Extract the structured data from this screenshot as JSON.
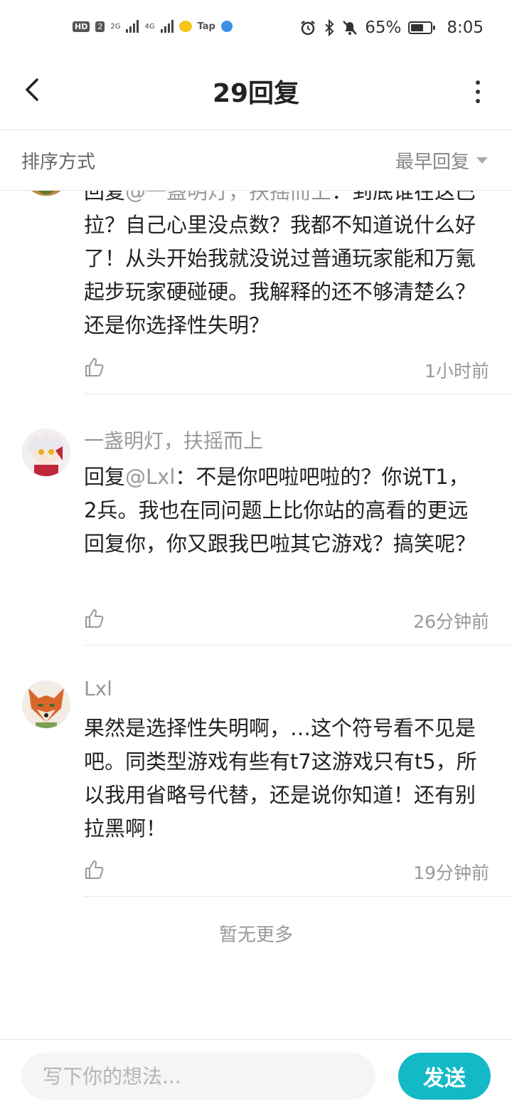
{
  "status_bar": {
    "left_labels": [
      "HD",
      "2",
      "2G",
      "4G",
      "Tap"
    ],
    "battery_text": "65%",
    "battery_level": 0.65,
    "time": "8:05",
    "icons": [
      "alarm-icon",
      "bluetooth-icon",
      "mute-icon",
      "battery-icon"
    ]
  },
  "header": {
    "title": "29回复",
    "back_icon": "chevron-left-icon",
    "more_icon": "more-vertical-icon"
  },
  "sort": {
    "label": "排序方式",
    "selected": "最早回复"
  },
  "comments": [
    {
      "author": "",
      "reply_prefix": "回复",
      "mention": "@一盏明灯，扶摇而上",
      "text": "：到底谁在这巴拉？自己心里没点数？我都不知道说什么好了！从头开始我就没说过普通玩家能和万氪起步玩家硬碰硬。我解释的还不够清楚么？还是你选择性失明？",
      "time": "1小时前"
    },
    {
      "author": "一盏明灯，扶摇而上",
      "reply_prefix": "回复",
      "mention": "@Lxl",
      "text": "：不是你吧啦吧啦的？你说T1，2兵。我也在同问题上比你站的高看的更远回复你，你又跟我巴啦其它游戏？搞笑呢？",
      "time": "26分钟前"
    },
    {
      "author": "Lxl",
      "reply_prefix": "",
      "mention": "",
      "text": "果然是选择性失明啊，…这个符号看不见是吧。同类型游戏有些有t7这游戏只有t5，所以我用省略号代替，还是说你知道！还有别拉黑啊！",
      "time": "19分钟前"
    }
  ],
  "footer_text": "暂无更多",
  "composer": {
    "placeholder": "写下你的想法...",
    "send_label": "发送"
  },
  "colors": {
    "accent": "#14b9c8",
    "muted": "#999999",
    "text": "#222222"
  }
}
